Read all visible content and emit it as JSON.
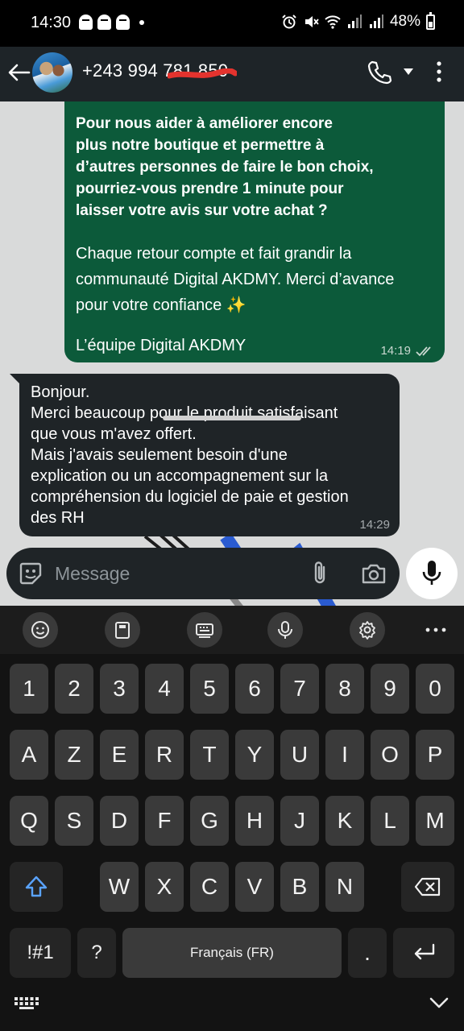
{
  "status_bar": {
    "time": "14:30",
    "battery": "48%"
  },
  "header": {
    "contact": "+243 994 781 850"
  },
  "messages": {
    "outgoing": {
      "bold_text": "Pour nous aider à améliorer encore\nplus notre boutique et permettre à\nd’autres personnes de faire le bon choix,\npourriez-vous prendre 1 minute pour\nlaisser votre avis sur votre achat ?",
      "body_text": "Chaque retour compte et fait grandir la\ncommunauté Digital AKDMY. Merci d’avance\npour votre confiance ✨",
      "signature": "L’équipe Digital AKDMY",
      "time": "14:19"
    },
    "incoming": {
      "text": "Bonjour.\nMerci beaucoup pour le produit satisfaisant\nque vous m'avez offert.\nMais j'avais seulement besoin d'une\nexplication ou un accompagnement sur la\ncompréhension du logiciel de paie et gestion\ndes RH",
      "time": "14:29"
    }
  },
  "composer": {
    "placeholder": "Message"
  },
  "keyboard": {
    "number_row": [
      "1",
      "2",
      "3",
      "4",
      "5",
      "6",
      "7",
      "8",
      "9",
      "0"
    ],
    "row1": [
      "A",
      "Z",
      "E",
      "R",
      "T",
      "Y",
      "U",
      "I",
      "O",
      "P"
    ],
    "row2": [
      "Q",
      "S",
      "D",
      "F",
      "G",
      "H",
      "J",
      "K",
      "L",
      "M"
    ],
    "row3": [
      "W",
      "X",
      "C",
      "V",
      "B",
      "N"
    ],
    "symbols_key": "!#1",
    "question_key": "?",
    "space_label": "Français (FR)",
    "period_key": "."
  },
  "colors": {
    "outgoing_bubble": "#0c5a3a",
    "incoming_bubble": "#1f2427",
    "chat_background": "#d9dada",
    "header": "#1e2428",
    "read_receipt": "#c9d8d0"
  }
}
